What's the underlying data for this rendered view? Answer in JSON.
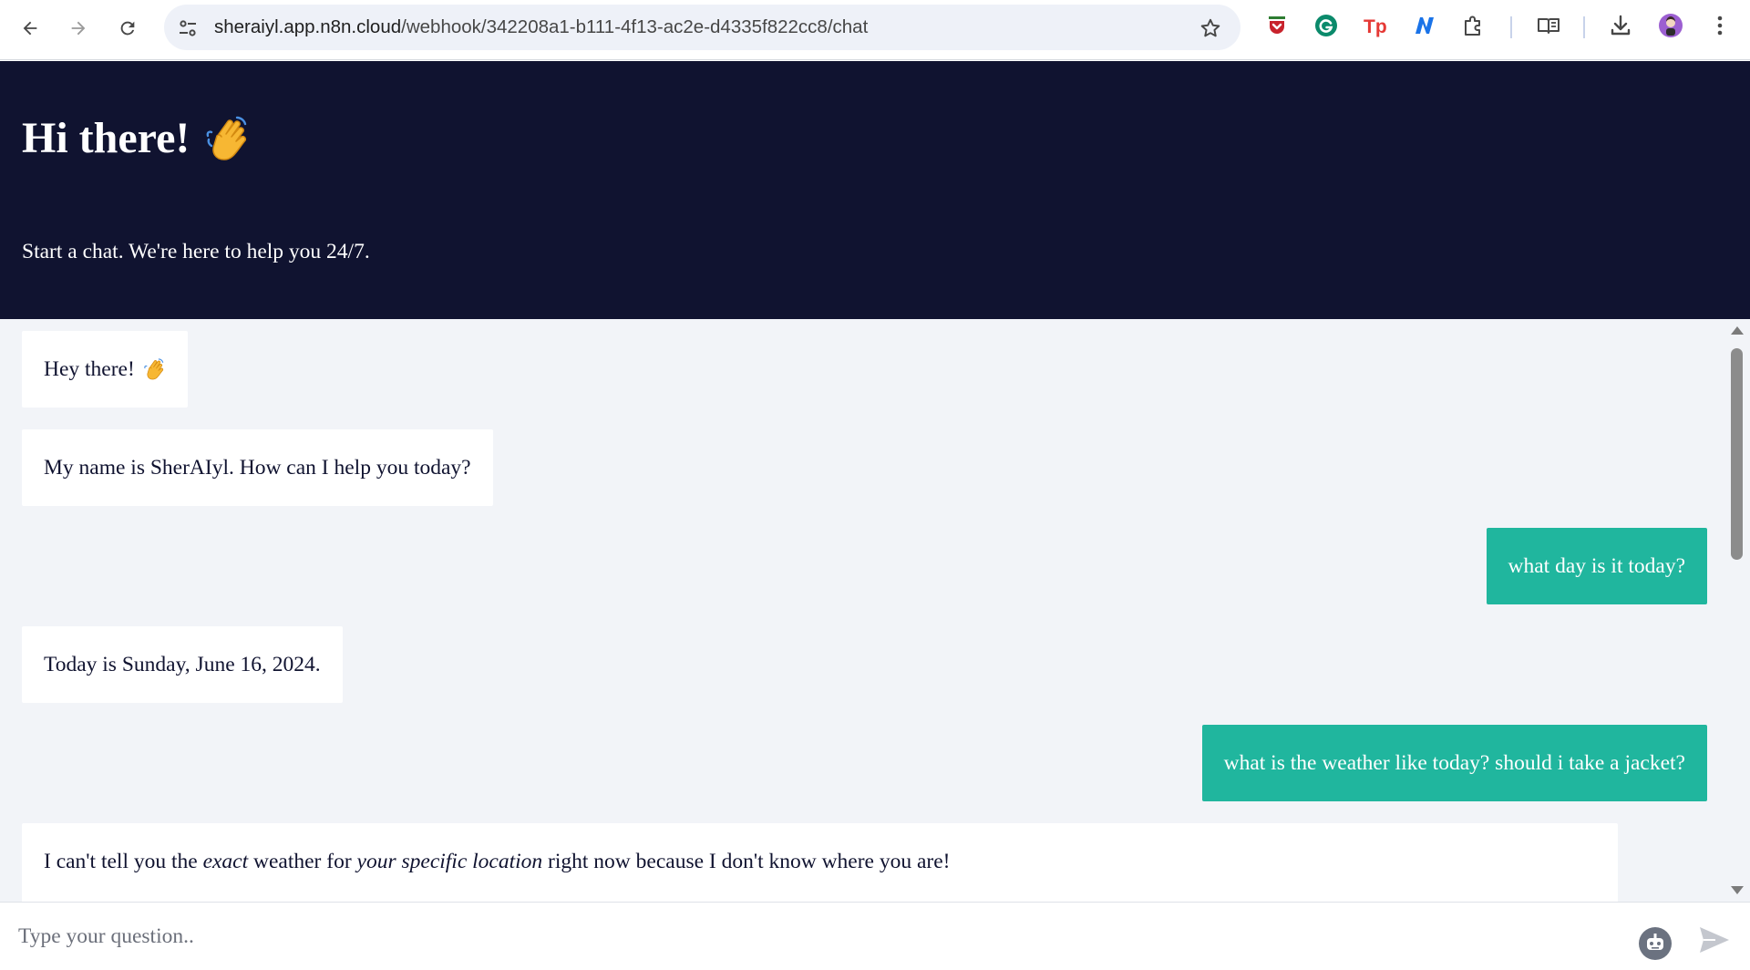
{
  "browser": {
    "url_host": "sheraiyl.app.n8n.cloud",
    "url_path": "/webhook/342208a1-b111-4f13-ac2e-d4335f822cc8/chat",
    "nav_icons": [
      "back-arrow-icon",
      "forward-arrow-icon",
      "reload-icon"
    ],
    "site_info_icon": "tune-icon",
    "bookmark_icon": "star-icon",
    "extension_icons": [
      "pocket-icon",
      "grammarly-icon",
      "tp-icon",
      "n-icon",
      "puzzle-icon",
      "reading-list-icon",
      "download-icon",
      "profile-avatar-icon",
      "more-vert-icon"
    ],
    "ext_text": {
      "tp": "Tp"
    },
    "colors": {
      "omnibox": "#eef1f8",
      "pocket": "#c8232c",
      "grammarly": "#15c39a",
      "tp": "#e53935",
      "n": "#1a73e8",
      "avatar": "#9c5fd1"
    }
  },
  "header": {
    "title": "Hi there!",
    "title_emoji_icon": "waving-hand-icon",
    "subtitle": "Start a chat. We're here to help you 24/7.",
    "background_color": "#101330"
  },
  "messages": [
    {
      "role": "bot",
      "text": "Hey there!",
      "emoji_icon": "waving-hand-icon"
    },
    {
      "role": "bot",
      "text": "My name is SherAIyl. How can I help you today?"
    },
    {
      "role": "user",
      "text": "what day is it today?"
    },
    {
      "role": "bot",
      "text": "Today is Sunday, June 16, 2024."
    },
    {
      "role": "user",
      "text": "what is the weather like today? should i take a jacket?"
    },
    {
      "role": "bot",
      "parts": [
        "I can't tell you the ",
        "exact",
        " weather for ",
        "your specific location",
        " right now because I don't know where you are!"
      ]
    }
  ],
  "colors": {
    "user_bubble": "#20b69e",
    "bot_bubble": "#ffffff",
    "messages_background": "#f2f4f8"
  },
  "input": {
    "placeholder": "Type your question..",
    "value": "",
    "bot_icon": "robot-icon",
    "send_icon": "send-icon"
  }
}
